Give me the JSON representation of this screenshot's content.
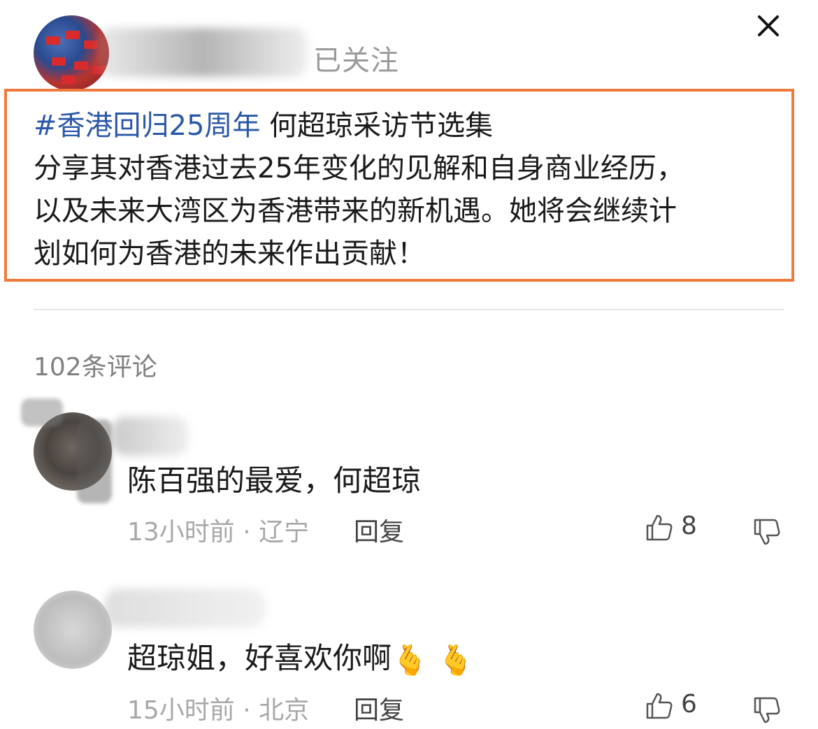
{
  "header": {
    "follow_status": "已关注"
  },
  "post": {
    "hashtag": "#香港回归25周年",
    "line1_rest": " 何超琼采访节选集",
    "line2": "分享其对香港过去25年变化的见解和自身商业经历，",
    "line3": "以及未来大湾区为香港带来的新机遇。她将会继续计",
    "line4": "划如何为香港的未来作出贡献！"
  },
  "comments_section": {
    "count_label": "102条评论"
  },
  "comments": [
    {
      "text": "陈百强的最爱，何超琼",
      "meta": "13小时前 · 辽宁",
      "reply_label": "回复",
      "likes": "8"
    },
    {
      "text": "超琼姐，好喜欢你啊",
      "emoji": "🫰 🫰",
      "meta": "15小时前 · 北京",
      "reply_label": "回复",
      "likes": "6"
    }
  ],
  "icons": {
    "close": "close-icon",
    "like": "thumbs-up-icon",
    "dislike": "thumbs-down-icon"
  },
  "colors": {
    "hashtag": "#2b58a8",
    "highlight_border": "#f07a3c"
  }
}
